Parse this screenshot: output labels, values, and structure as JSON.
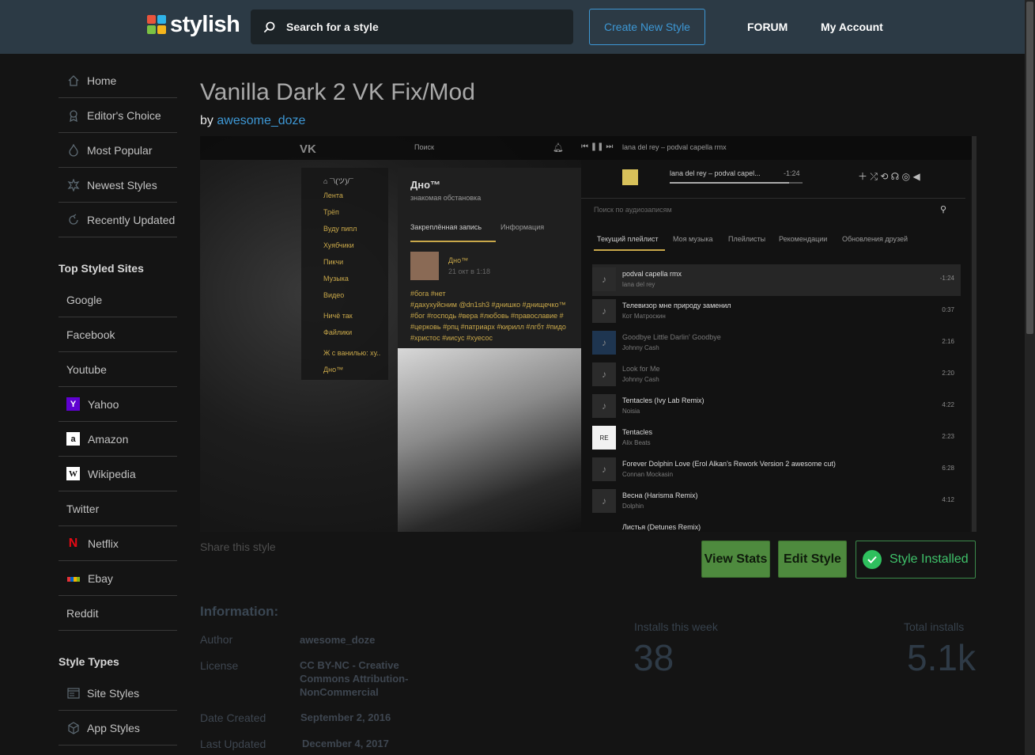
{
  "header": {
    "logo_text": "stylish",
    "search_placeholder": "Search for a style",
    "create_button": "Create New Style",
    "forum": "FORUM",
    "account": "My Account"
  },
  "sidebar": {
    "nav": [
      {
        "label": "Home",
        "icon": "home-icon"
      },
      {
        "label": "Editor's Choice",
        "icon": "award-icon"
      },
      {
        "label": "Most Popular",
        "icon": "flame-icon"
      },
      {
        "label": "Newest Styles",
        "icon": "star-burst-icon"
      },
      {
        "label": "Recently Updated",
        "icon": "refresh-icon"
      }
    ],
    "top_sites_heading": "Top Styled Sites",
    "sites": [
      {
        "label": "Google",
        "icon": ""
      },
      {
        "label": "Facebook",
        "icon": ""
      },
      {
        "label": "Youtube",
        "icon": ""
      },
      {
        "label": "Yahoo",
        "icon": "yahoo-icon"
      },
      {
        "label": "Amazon",
        "icon": "amazon-icon"
      },
      {
        "label": "Wikipedia",
        "icon": "wikipedia-icon"
      },
      {
        "label": "Twitter",
        "icon": ""
      },
      {
        "label": "Netflix",
        "icon": "netflix-icon"
      },
      {
        "label": "Ebay",
        "icon": "ebay-icon"
      },
      {
        "label": "Reddit",
        "icon": ""
      }
    ],
    "style_types_heading": "Style Types",
    "types": [
      {
        "label": "Site Styles",
        "icon": "browser-window-icon"
      },
      {
        "label": "App Styles",
        "icon": "cube-icon"
      }
    ]
  },
  "style": {
    "title": "Vanilla Dark 2 VK Fix/Mod",
    "by": "by",
    "author": "awesome_doze"
  },
  "preview": {
    "search": "Поиск",
    "now_playing": "lana del rey – podval capella rmx",
    "player_track": "lana del rey – podval capel...",
    "player_time": "-1:24",
    "search_audio": "Поиск по аудиозаписям",
    "tabs": [
      "Текущий плейлист",
      "Моя музыка",
      "Плейлисты",
      "Рекомендации",
      "Обновления друзей"
    ],
    "menu": [
      "Лента",
      "Трёп",
      "Вуду пипл",
      "Хуябчики",
      "Пикчи",
      "Музыка",
      "Видео",
      "Ничё так",
      "Файлики",
      "Ж с ванилью: ху..",
      "Дно™"
    ],
    "group_name": "Дно™",
    "group_status": "знакомая обстановка",
    "post_tabs": [
      "Закреплённая запись",
      "Информация"
    ],
    "post_author": "Дно™",
    "post_date": "21 окт в 1:18",
    "post_lines": [
      "#бога #нет",
      "#дахухуйсним @dn1sh3 #днишко #днищечко™",
      "#бог #господь #вера #любовь #православие #",
      "#церковь #рпц #патриарх #кирилл #лгбт #пидо",
      "#христос #иисус #хуесос"
    ],
    "tracks": [
      {
        "title": "podval capella rmx",
        "artist": "lana del rey",
        "dur": "-1:24"
      },
      {
        "title": "Телевизор мне природу заменил",
        "artist": "Кот Матроскин",
        "dur": "0:37"
      },
      {
        "title": "Goodbye Little Darlin' Goodbye",
        "artist": "Johnny Cash",
        "dur": "2:16"
      },
      {
        "title": "Look for Me",
        "artist": "Johnny Cash",
        "dur": "2:20"
      },
      {
        "title": "Tentacles (Ivy Lab Remix)",
        "artist": "Noisia",
        "dur": "4:22"
      },
      {
        "title": "Tentacles",
        "artist": "Alix Beats",
        "dur": "2:23"
      },
      {
        "title": "Forever Dolphin Love (Erol Alkan's Rework Version 2 awesome cut)",
        "artist": "Connan Mockasin",
        "dur": "6:28"
      },
      {
        "title": "Весна (Harisma Remix)",
        "artist": "Dolphin",
        "dur": "4:12"
      },
      {
        "title": "Листья (Detunes Remix)",
        "artist": "",
        "dur": ""
      }
    ]
  },
  "actions": {
    "share": "Share this style",
    "view_stats": "View Stats",
    "edit_style": "Edit Style",
    "installed": "Style Installed"
  },
  "information": {
    "heading": "Information:",
    "author_label": "Author",
    "author_value": "awesome_doze",
    "license_label": "License",
    "license_value": "CC BY-NC - Creative Commons Attribution-NonCommercial",
    "created_label": "Date Created",
    "created_value": "September 2, 2016",
    "updated_label": "Last Updated",
    "updated_value": "December 4, 2017"
  },
  "stats": {
    "week_label": "Installs this week",
    "week_value": "38",
    "total_label": "Total installs",
    "total_value": "5.1k"
  },
  "colors": {
    "header_bg": "#2c3a45",
    "accent_blue": "#3d97d4",
    "button_green": "#4e8a3e",
    "installed_green": "#3fc26a"
  }
}
